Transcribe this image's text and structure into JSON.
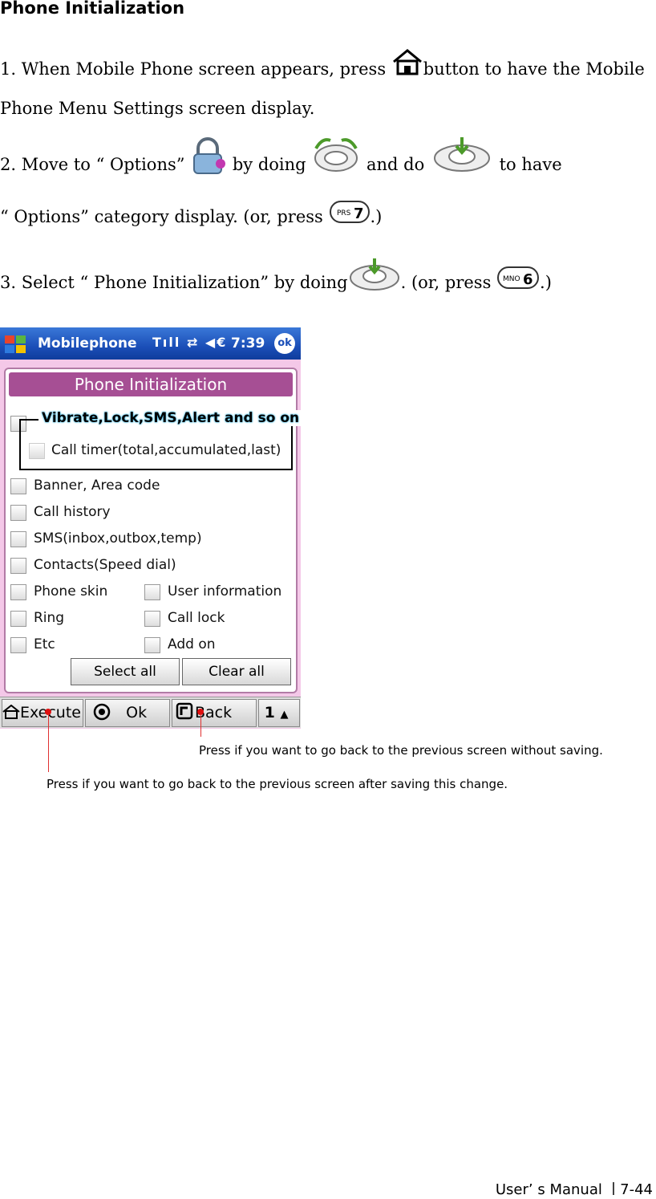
{
  "heading": "Phone Initialization",
  "step1": {
    "a": "1. When Mobile Phone screen appears, press ",
    "b": "button to have the Mobile",
    "c": "Phone Menu Settings screen display."
  },
  "step2": {
    "a": "2. Move to “ Options” ",
    "b": " by doing ",
    "c": " and do ",
    "d": " to have",
    "e": "“ Options”  category display. (or, press ",
    "f": ".)"
  },
  "step3": {
    "a": "3. Select “ Phone Initialization”  by doing",
    "b": ". (or, press ",
    "c": ".)"
  },
  "keys": {
    "prs": "PRS",
    "seven": "7",
    "mno": "MNO",
    "six": "6"
  },
  "phone": {
    "app_name": "Mobilephone",
    "status_icons": "Tıll ⇄ ◀€",
    "time": "7:39",
    "ok": "ok",
    "title": "Phone Initialization",
    "group_title": "Vibrate,Lock,SMS,Alert and so on",
    "items": {
      "call_timer": "Call timer(total,accumulated,last)",
      "banner": "Banner, Area code",
      "history": "Call history",
      "sms": "SMS(inbox,outbox,temp)",
      "contacts": "Contacts(Speed dial)",
      "skin": "Phone skin",
      "user": "User information",
      "ring": "Ring",
      "lock": "Call lock",
      "etc": "Etc",
      "addon": "Add on"
    },
    "select_all": "Select all",
    "clear_all": "Clear all",
    "toolbar": {
      "execute": "Execute",
      "ok": "Ok",
      "back": "Back",
      "page": "1"
    }
  },
  "notes": {
    "back": "Press if you want to go back to the previous screen without saving.",
    "execute": "Press if you want to go back to the previous screen after saving this change."
  },
  "footer": "User’ s Manual ㅣ7-44"
}
